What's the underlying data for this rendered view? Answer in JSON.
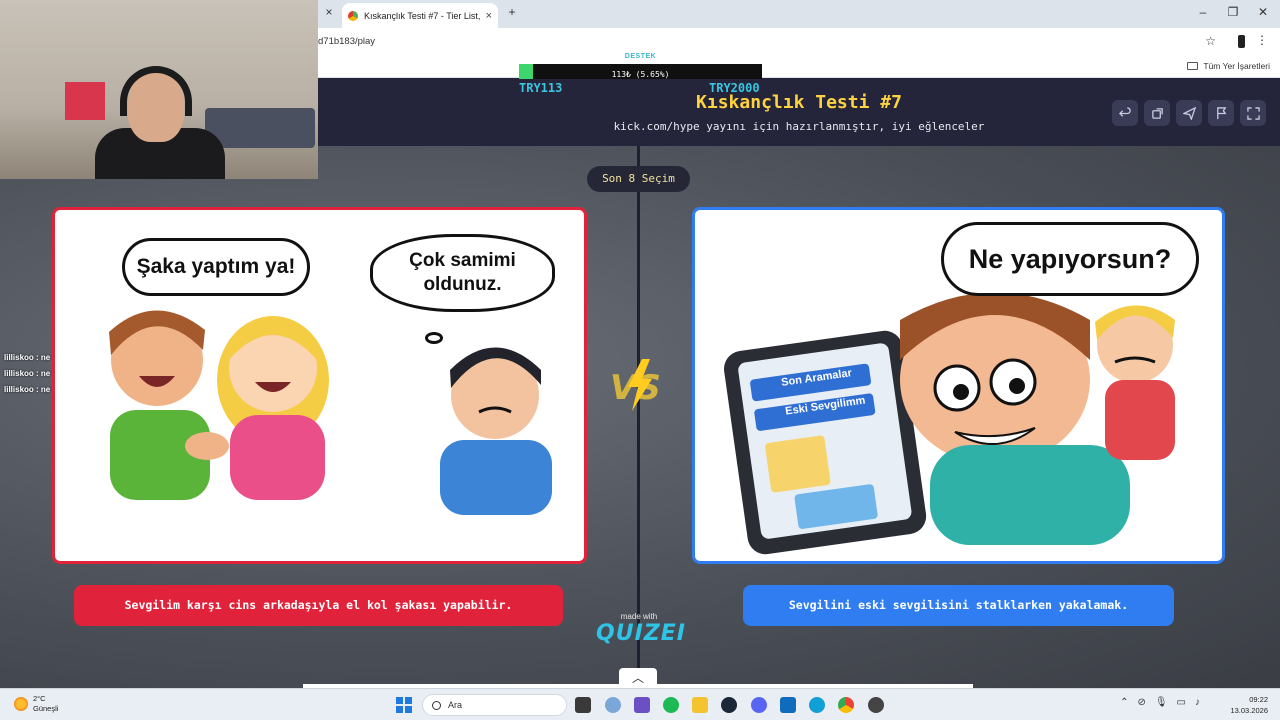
{
  "browser": {
    "tab_title": "Kıskançlık Testi #7 - Tier List, Ki",
    "url": "d71b183/play",
    "bookmarks_label": "Tüm Yer İşaretleri",
    "tab_close": "×",
    "new_tab": "+"
  },
  "donation": {
    "label": "DESTEK",
    "progress_text": "113₺ (5.65%)",
    "progress_percent": 5.65,
    "current_label": "TRY113",
    "goal_label": "TRY2000"
  },
  "header": {
    "title": "Kıskançlık Testi #7",
    "subtitle": "kick.com/hype yayını için hazırlanmıştır, iyi eğlenceler",
    "buttons": [
      "undo-icon",
      "share-icon",
      "send-icon",
      "flag-icon",
      "fullscreen-icon"
    ]
  },
  "round": {
    "label": "Son 8 Seçim"
  },
  "left": {
    "bubble1": "Şaka yaptım ya!",
    "bubble2": "Çok samimi oldunuz.",
    "caption": "Sevgilim karşı cins arkadaşıyla el kol şakası yapabilir."
  },
  "right": {
    "bubble": "Ne yapıyorsun?",
    "phone_search": "Son Aramalar",
    "phone_ex": "Eski Sevgilimm",
    "caption": "Sevgilini eski sevgilisini stalklarken yakalamak."
  },
  "branding": {
    "made_with": "made with",
    "brand": "QUIZEI"
  },
  "chat": [
    "lilliskoo : ne",
    "lilliskoo : ne",
    "lilliskoo : ne"
  ],
  "taskbar": {
    "temperature": "2°C",
    "weather": "Güneşli",
    "search": "Ara",
    "time": "09:22",
    "date": "13.03.2026"
  },
  "colors": {
    "left_accent": "#e0223a",
    "right_accent": "#2f7df0",
    "title": "#ffd23f"
  }
}
